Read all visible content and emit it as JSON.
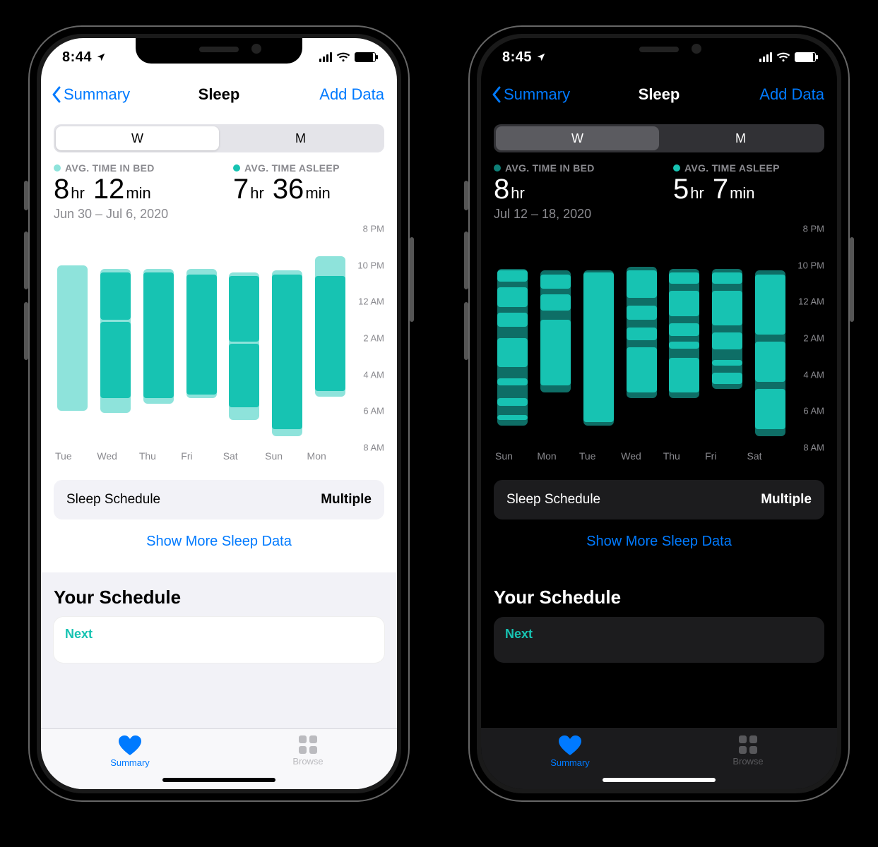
{
  "colors": {
    "accent": "#007aff",
    "teal": "#17c3b2",
    "bed": "#8ee3db"
  },
  "chart_axis": {
    "y_ticks": [
      "8 PM",
      "10 PM",
      "12 AM",
      "2 AM",
      "4 AM",
      "6 AM",
      "8 AM"
    ],
    "y_range_hours": [
      20,
      32
    ]
  },
  "phones": {
    "left": {
      "theme": "light",
      "status": {
        "time": "8:44"
      },
      "nav": {
        "back": "Summary",
        "title": "Sleep",
        "action": "Add Data"
      },
      "segmented": {
        "options": [
          "W",
          "M"
        ],
        "selected_index": 0
      },
      "metrics": {
        "bed": {
          "label": "AVG. TIME IN BED",
          "hr": "8",
          "min": "12"
        },
        "asleep": {
          "label": "AVG. TIME ASLEEP",
          "hr": "7",
          "min": "36"
        }
      },
      "date_range": "Jun 30 – Jul 6, 2020",
      "chart_data": {
        "type": "bar",
        "title": "Sleep – Avg time in bed & asleep (week view)",
        "xlabel": "",
        "ylabel": "",
        "y_axis_hours": {
          "start": 20,
          "end": 32
        },
        "categories": [
          "Tue",
          "Wed",
          "Thu",
          "Fri",
          "Sat",
          "Sun",
          "Mon"
        ],
        "series": [
          {
            "name": "In Bed (start-end clock hr)",
            "values": [
              [
                22.0,
                30.0
              ],
              [
                22.2,
                30.1
              ],
              [
                22.2,
                29.6
              ],
              [
                22.2,
                29.3
              ],
              [
                22.4,
                30.5
              ],
              [
                22.3,
                31.4
              ],
              [
                21.5,
                29.2
              ]
            ]
          },
          {
            "name": "Asleep segments (clock hr)",
            "values": [
              [],
              [
                [
                  22.4,
                  25.0
                ],
                [
                  25.1,
                  29.3
                ]
              ],
              [
                [
                  22.4,
                  29.3
                ]
              ],
              [
                [
                  22.5,
                  29.1
                ]
              ],
              [
                [
                  22.6,
                  26.2
                ],
                [
                  26.3,
                  29.8
                ]
              ],
              [
                [
                  22.5,
                  31.0
                ]
              ],
              [
                [
                  22.6,
                  28.9
                ]
              ]
            ]
          }
        ],
        "annotations": []
      },
      "schedule_row": {
        "label": "Sleep Schedule",
        "value": "Multiple"
      },
      "more_link": "Show More Sleep Data",
      "section": {
        "title": "Your Schedule",
        "next_label": "Next"
      },
      "tabs": {
        "summary": "Summary",
        "browse": "Browse",
        "active": 0
      }
    },
    "right": {
      "theme": "dark",
      "status": {
        "time": "8:45"
      },
      "nav": {
        "back": "Summary",
        "title": "Sleep",
        "action": "Add Data"
      },
      "segmented": {
        "options": [
          "W",
          "M"
        ],
        "selected_index": 0
      },
      "metrics": {
        "bed": {
          "label": "AVG. TIME IN BED",
          "hr": "8",
          "min": ""
        },
        "asleep": {
          "label": "AVG. TIME ASLEEP",
          "hr": "5",
          "min": "7"
        }
      },
      "date_range": "Jul 12 – 18, 2020",
      "chart_data": {
        "type": "bar",
        "title": "Sleep – Avg time in bed & asleep (week view)",
        "xlabel": "",
        "ylabel": "",
        "y_axis_hours": {
          "start": 20,
          "end": 32
        },
        "categories": [
          "Sun",
          "Mon",
          "Tue",
          "Wed",
          "Thu",
          "Fri",
          "Sat"
        ],
        "series": [
          {
            "name": "In Bed (start-end clock hr)",
            "values": [
              [
                22.2,
                30.8
              ],
              [
                22.3,
                29.0
              ],
              [
                22.3,
                30.8
              ],
              [
                22.1,
                29.3
              ],
              [
                22.2,
                29.3
              ],
              [
                22.2,
                28.8
              ],
              [
                22.3,
                31.4
              ]
            ]
          },
          {
            "name": "Asleep segments (clock hr)",
            "values": [
              [
                [
                  22.3,
                  22.9
                ],
                [
                  23.2,
                  24.3
                ],
                [
                  24.6,
                  25.4
                ],
                [
                  26.0,
                  27.6
                ],
                [
                  28.2,
                  28.6
                ],
                [
                  29.3,
                  29.7
                ],
                [
                  30.2,
                  30.5
                ]
              ],
              [
                [
                  22.5,
                  23.3
                ],
                [
                  23.6,
                  24.5
                ],
                [
                  25.0,
                  28.6
                ]
              ],
              [
                [
                  22.4,
                  30.6
                ]
              ],
              [
                [
                  22.3,
                  23.8
                ],
                [
                  24.2,
                  25.0
                ],
                [
                  25.4,
                  26.1
                ],
                [
                  26.5,
                  29.0
                ]
              ],
              [
                [
                  22.4,
                  23.0
                ],
                [
                  23.4,
                  24.8
                ],
                [
                  25.2,
                  25.9
                ],
                [
                  26.2,
                  26.6
                ],
                [
                  27.1,
                  29.0
                ]
              ],
              [
                [
                  22.4,
                  23.0
                ],
                [
                  23.4,
                  25.3
                ],
                [
                  25.7,
                  26.6
                ],
                [
                  27.2,
                  27.5
                ],
                [
                  27.9,
                  28.5
                ]
              ],
              [
                [
                  22.5,
                  25.8
                ],
                [
                  26.2,
                  28.4
                ],
                [
                  28.8,
                  31.0
                ]
              ]
            ]
          }
        ],
        "annotations": []
      },
      "schedule_row": {
        "label": "Sleep Schedule",
        "value": "Multiple"
      },
      "more_link": "Show More Sleep Data",
      "section": {
        "title": "Your Schedule",
        "next_label": "Next"
      },
      "tabs": {
        "summary": "Summary",
        "browse": "Browse",
        "active": 0
      }
    }
  }
}
